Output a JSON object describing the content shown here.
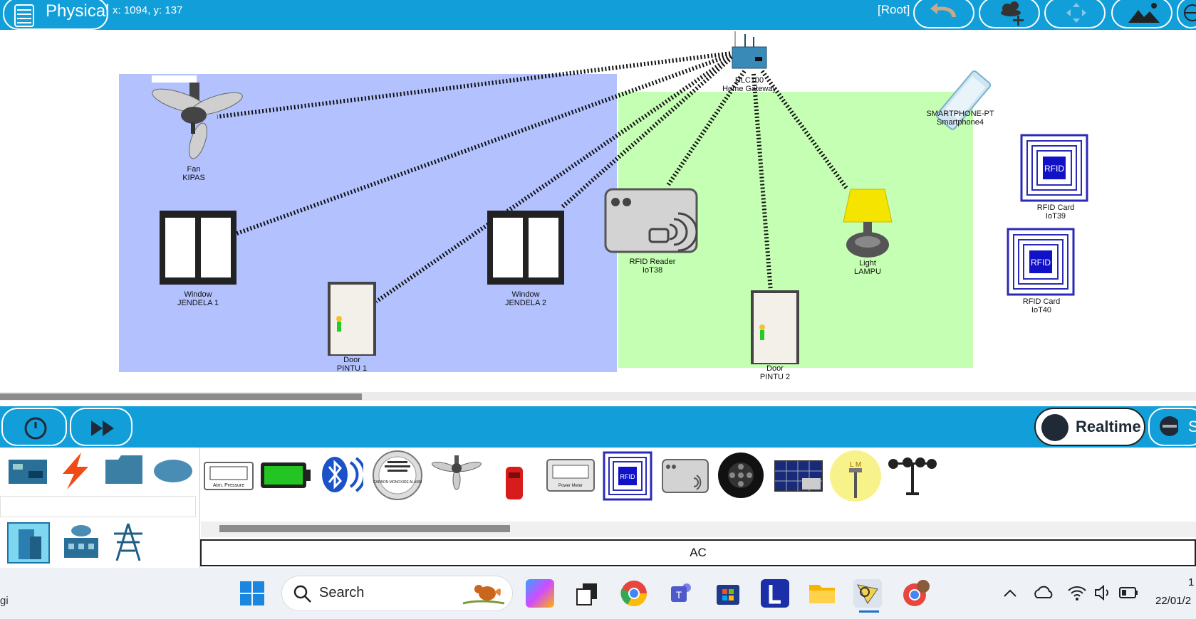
{
  "topbar": {
    "mode_label": "Physical",
    "coordinates": "x: 1094, y: 137",
    "root_label": "[Root]",
    "buttons": [
      "undo-icon",
      "add-cluster-icon",
      "move-icon",
      "background-image-icon",
      "globe-icon"
    ]
  },
  "canvas": {
    "rooms": [
      {
        "color": "#b3c2ff"
      },
      {
        "color": "#c5ffb3"
      }
    ],
    "devices": [
      {
        "type": "DLC100",
        "name": "Home Gateway"
      },
      {
        "type": "SMARTPHONE-PT",
        "name": "Smartphone4"
      },
      {
        "type": "Fan",
        "name": "KIPAS"
      },
      {
        "type": "Window",
        "name": "JENDELA 1"
      },
      {
        "type": "Window",
        "name": "JENDELA 2"
      },
      {
        "type": "Door",
        "name": "PINTU 1"
      },
      {
        "type": "RFID Reader",
        "name": "IoT38"
      },
      {
        "type": "Door",
        "name": "PINTU 2"
      },
      {
        "type": "Light",
        "name": "LAMPU"
      },
      {
        "type": "RFID Card",
        "name": "IoT39"
      },
      {
        "type": "RFID Card",
        "name": "IoT40"
      }
    ]
  },
  "simbar": {
    "mode_label": "Realtime",
    "extra_label": "S"
  },
  "device_panel": {
    "categories": [
      "board-icon",
      "lightning-icon",
      "folder-icon",
      "cloud-icon"
    ],
    "subcategories": [
      "building-icon",
      "factory-icon",
      "power-tower-icon"
    ],
    "devices": [
      "atm-pressure-icon",
      "battery-icon",
      "bluetooth-icon",
      "carbon-monoxide-alarm-icon",
      "ceiling-fan-icon",
      "car-icon",
      "power-meter-icon",
      "rfid-card-icon",
      "rfid-reader-icon",
      "speaker-icon",
      "solar-panel-icon",
      "street-lamp-icon",
      "wind-sensor-icon"
    ],
    "icon_texts": {
      "atm": "Atm. Pressure",
      "co": "CARBON MONOXIDE ALARM",
      "power": "Power Meter",
      "rfid": "RFID",
      "lamp": "L M"
    },
    "selected_name": "AC"
  },
  "taskbar": {
    "search_placeholder": "Search",
    "left_text": "gi",
    "time": "1",
    "date": "22/01/2"
  }
}
